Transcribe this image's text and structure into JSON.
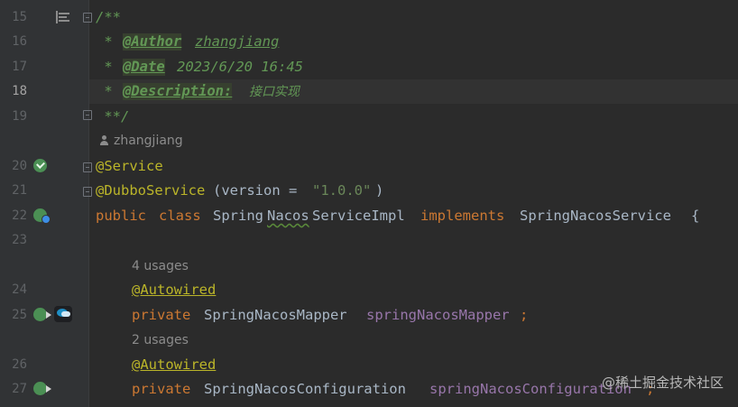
{
  "editor": {
    "line_numbers": [
      "15",
      "16",
      "17",
      "18",
      "19",
      "20",
      "21",
      "22",
      "23",
      "24",
      "25",
      "26",
      "27"
    ],
    "active_line": "18",
    "doc": {
      "open": "/**",
      "star": " * ",
      "author_tag": "@Author",
      "author_value": "zhangjiang",
      "date_tag": "@Date",
      "date_value": "2023/6/20 16:45",
      "desc_tag": "@Description:",
      "desc_value": "接口实现",
      "close": " **/"
    },
    "author_hint": "zhangjiang",
    "service_annotation": "@Service",
    "dubbo_annotation": "@DubboService",
    "dubbo_args_open": "(version = ",
    "dubbo_version": "\"1.0.0\"",
    "dubbo_args_close": ")",
    "class_line": {
      "kw_public": "public",
      "kw_class": "class",
      "class_name_prefix": "Spring",
      "class_name_squig": "Nacos",
      "class_name_suffix": "ServiceImpl",
      "kw_implements": "implements",
      "interface_name": "SpringNacosService",
      "brace": "{"
    },
    "usages_1": "4 usages",
    "autowired": "@Autowired",
    "field1": {
      "kw": "private",
      "type": "SpringNacosMapper",
      "name": "springNacosMapper",
      "semi": ";"
    },
    "usages_2": "2 usages",
    "field2": {
      "kw": "private",
      "type": "SpringNacosConfiguration",
      "name": "springNacosConfiguration",
      "semi": ";"
    }
  },
  "watermark": "@稀土掘金技术社区",
  "icons": {
    "structure": "structure-icon",
    "spring_bean": "spring-bean-icon",
    "autowire": "autowire-navigate-icon",
    "implemented": "implemented-icon",
    "user": "user-icon",
    "avatar": "avatar"
  },
  "colors": {
    "background": "#2b2b2b",
    "gutter": "#313335",
    "keyword": "#cc7832",
    "annotation": "#bbb529",
    "string": "#6a8759",
    "doc": "#629755",
    "field": "#9876aa",
    "text": "#a9b7c6"
  }
}
